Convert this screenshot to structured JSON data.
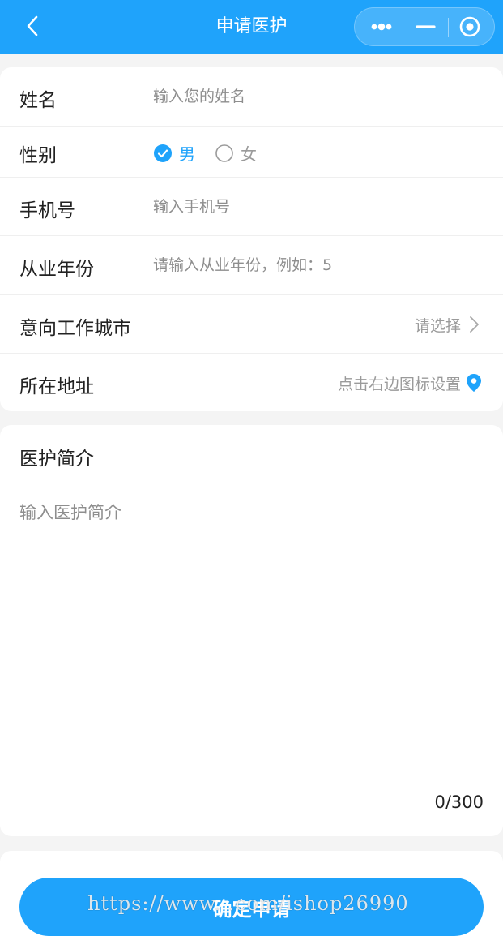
{
  "header": {
    "title": "申请医护"
  },
  "form": {
    "name": {
      "label": "姓名",
      "placeholder": "输入您的姓名"
    },
    "gender": {
      "label": "性别",
      "options": [
        {
          "label": "男",
          "checked": true
        },
        {
          "label": "女",
          "checked": false
        }
      ]
    },
    "phone": {
      "label": "手机号",
      "placeholder": "输入手机号"
    },
    "years": {
      "label": "从业年份",
      "placeholder": "请输入从业年份，例如：5"
    },
    "city": {
      "label": "意向工作城市",
      "value": "请选择"
    },
    "address": {
      "label": "所在地址",
      "value": "点击右边图标设置"
    }
  },
  "intro": {
    "title": "医护简介",
    "placeholder": "输入医护简介",
    "counter": "0/300"
  },
  "submit": {
    "label": "确定申请"
  },
  "watermark": "https://www.          .com/ishop26990",
  "colors": {
    "accent": "#1fa3fb",
    "text": "#222222",
    "placeholder": "#8e8e8e",
    "background": "#f4f4f4"
  }
}
